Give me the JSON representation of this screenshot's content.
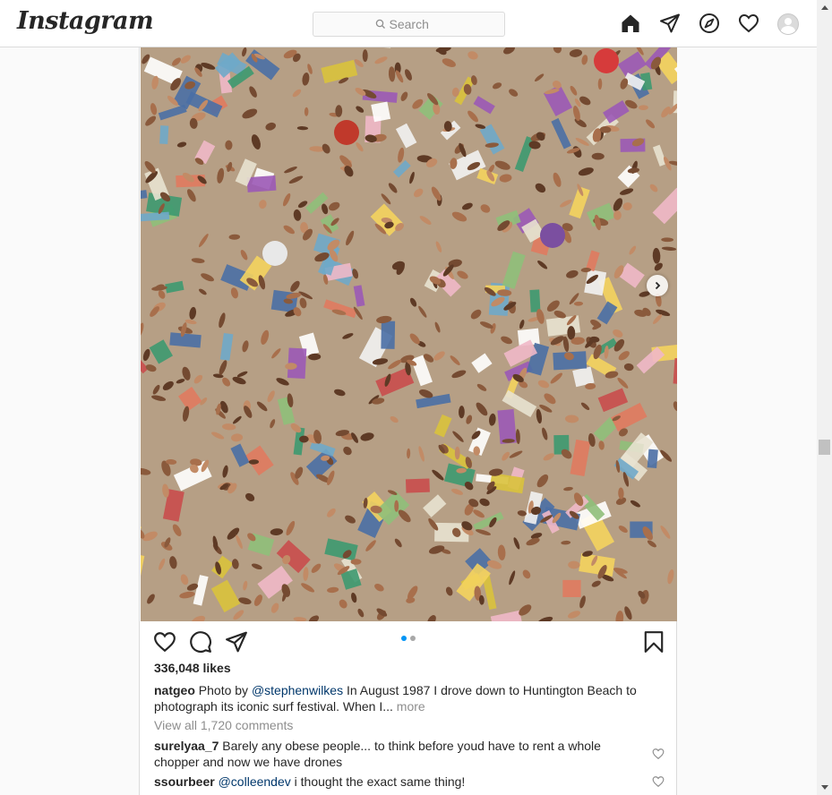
{
  "nav": {
    "logo": "Instagram",
    "search_placeholder": "Search"
  },
  "post": {
    "likes": "336,048 likes",
    "caption": {
      "user": "natgeo",
      "text_pre": "Photo by",
      "mention": "@stephenwilkes",
      "text_post": "In August 1987 I drove down to Huntington Beach to photograph its iconic surf festival. When I...",
      "more": "more"
    },
    "view_all_comments": "View all 1,720 comments",
    "comments": [
      {
        "user": "surelyaa_7",
        "text": "Barely any obese people... to think before youd have to rent a whole chopper and now we have drones"
      },
      {
        "user": "ssourbeer",
        "mention": "@colleendev",
        "text": "i thought the exact same thing!"
      }
    ],
    "carousel": {
      "slides": 2,
      "active": 1
    },
    "photo_description": "beach-aerial-photo"
  },
  "colors": {
    "accent": "#0095f6",
    "border": "#dbdbdb",
    "muted": "#8e8e8e",
    "sand": "#b69f85"
  }
}
